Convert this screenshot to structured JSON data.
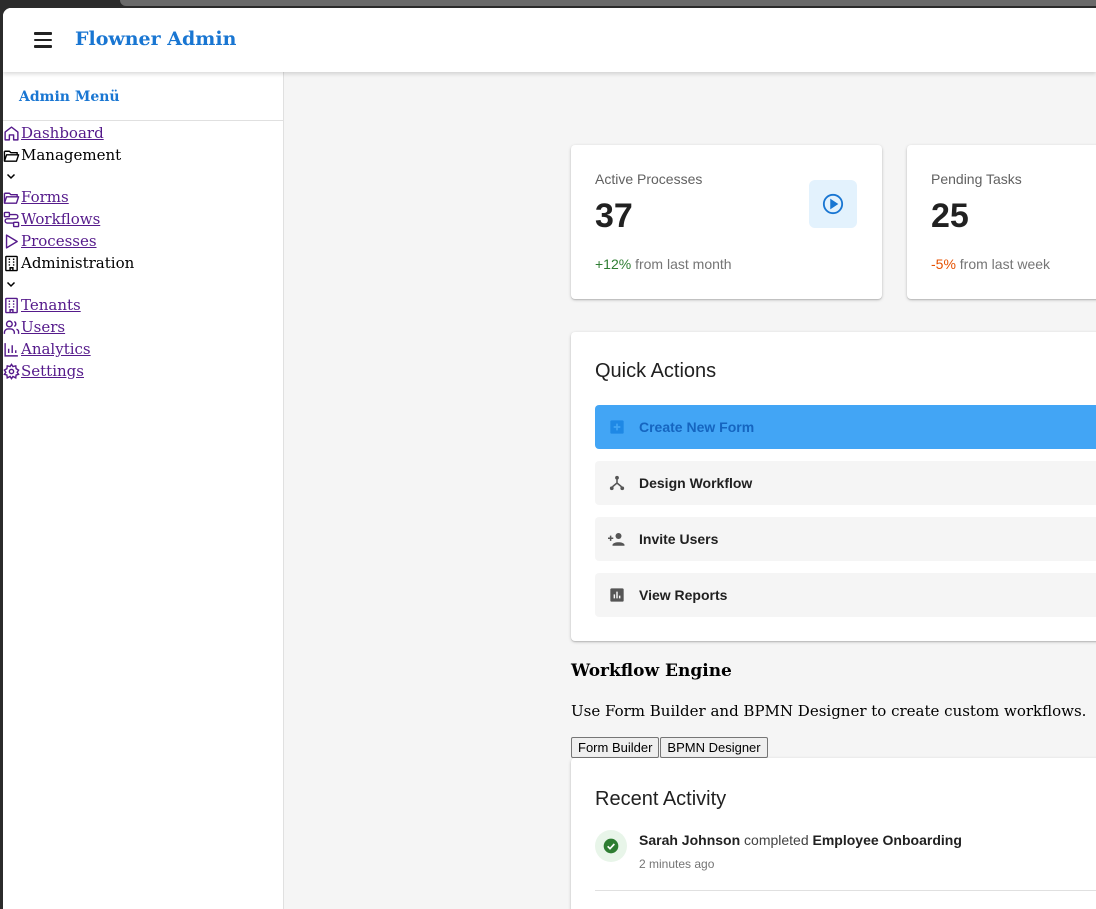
{
  "app": {
    "title": "Flowner Admin"
  },
  "sidebar": {
    "header": "Admin Menü",
    "items": [
      {
        "label": "Dashboard",
        "icon": "home-icon"
      },
      {
        "label": "Management",
        "icon": "folder-open-icon"
      },
      {
        "label": "Forms",
        "icon": "folder-icon"
      },
      {
        "label": "Workflows",
        "icon": "workflow-icon"
      },
      {
        "label": "Processes",
        "icon": "play-icon"
      },
      {
        "label": "Administration",
        "icon": "building-icon"
      },
      {
        "label": "Tenants",
        "icon": "building-icon"
      },
      {
        "label": "Users",
        "icon": "users-icon"
      },
      {
        "label": "Analytics",
        "icon": "bar-chart-icon"
      },
      {
        "label": "Settings",
        "icon": "gear-icon"
      }
    ]
  },
  "stats": [
    {
      "label": "Active Processes",
      "value": "37",
      "trend": "+12%",
      "trend_text": " from last month"
    },
    {
      "label": "Pending Tasks",
      "value": "25",
      "trend": "-5%",
      "trend_text": " from last week"
    }
  ],
  "quick_actions": {
    "title": "Quick Actions",
    "items": [
      {
        "label": "Create New Form",
        "icon": "add-box-icon"
      },
      {
        "label": "Design Workflow",
        "icon": "workflow-icon"
      },
      {
        "label": "Invite Users",
        "icon": "person-add-icon"
      },
      {
        "label": "View Reports",
        "icon": "report-icon"
      }
    ]
  },
  "workflow_engine": {
    "title": "Workflow Engine",
    "description": "Use Form Builder and BPMN Designer to create custom workflows.",
    "buttons": [
      "Form Builder",
      "BPMN Designer"
    ]
  },
  "recent_activity": {
    "title": "Recent Activity",
    "items": [
      {
        "user": "Sarah Johnson",
        "action": " completed ",
        "target": "Employee Onboarding",
        "time": "2 minutes ago"
      }
    ]
  },
  "colors": {
    "primary": "#1976d2",
    "accent_button": "#42a5f5",
    "success": "#2e7d32",
    "warning": "#e65100"
  }
}
